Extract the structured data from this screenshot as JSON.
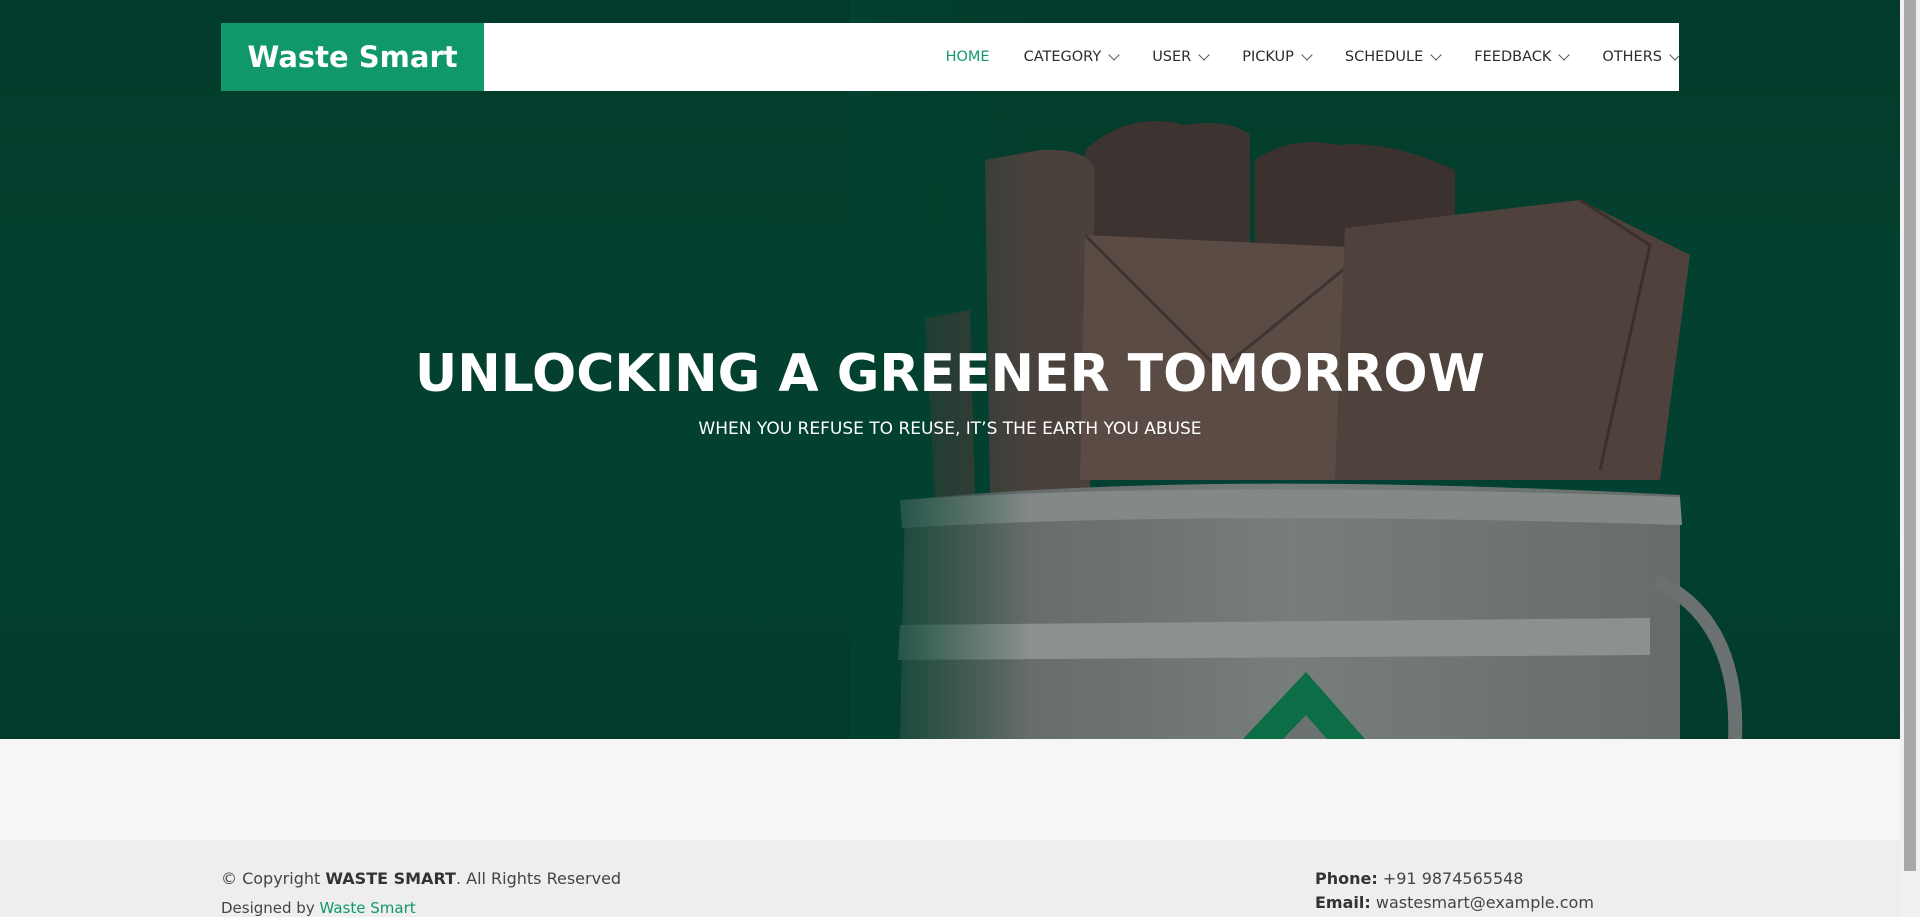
{
  "brand": {
    "name": "Waste Smart",
    "accent": "#10986b"
  },
  "nav": {
    "items": [
      {
        "label": "HOME",
        "active": true,
        "dropdown": false
      },
      {
        "label": "CATEGORY",
        "active": false,
        "dropdown": true
      },
      {
        "label": "USER",
        "active": false,
        "dropdown": true
      },
      {
        "label": "PICKUP",
        "active": false,
        "dropdown": true
      },
      {
        "label": "SCHEDULE",
        "active": false,
        "dropdown": true
      },
      {
        "label": "FEEDBACK",
        "active": false,
        "dropdown": true
      },
      {
        "label": "OTHERS",
        "active": false,
        "dropdown": true
      }
    ]
  },
  "hero": {
    "title": "UNLOCKING A GREENER TOMORROW",
    "subtitle": "WHEN YOU REFUSE TO REUSE, IT’S THE EARTH YOU ABUSE",
    "background_color": "#02402f"
  },
  "footer": {
    "copyright_prefix": "© Copyright ",
    "copyright_brand": "WASTE SMART",
    "copyright_suffix": ". All Rights Reserved",
    "designed_by_prefix": "Designed by ",
    "designed_by_link": "Waste Smart",
    "phone_label": "Phone:",
    "phone_value": " +91 9874565548",
    "email_label": "Email:",
    "email_value": " wastesmart@example.com"
  }
}
